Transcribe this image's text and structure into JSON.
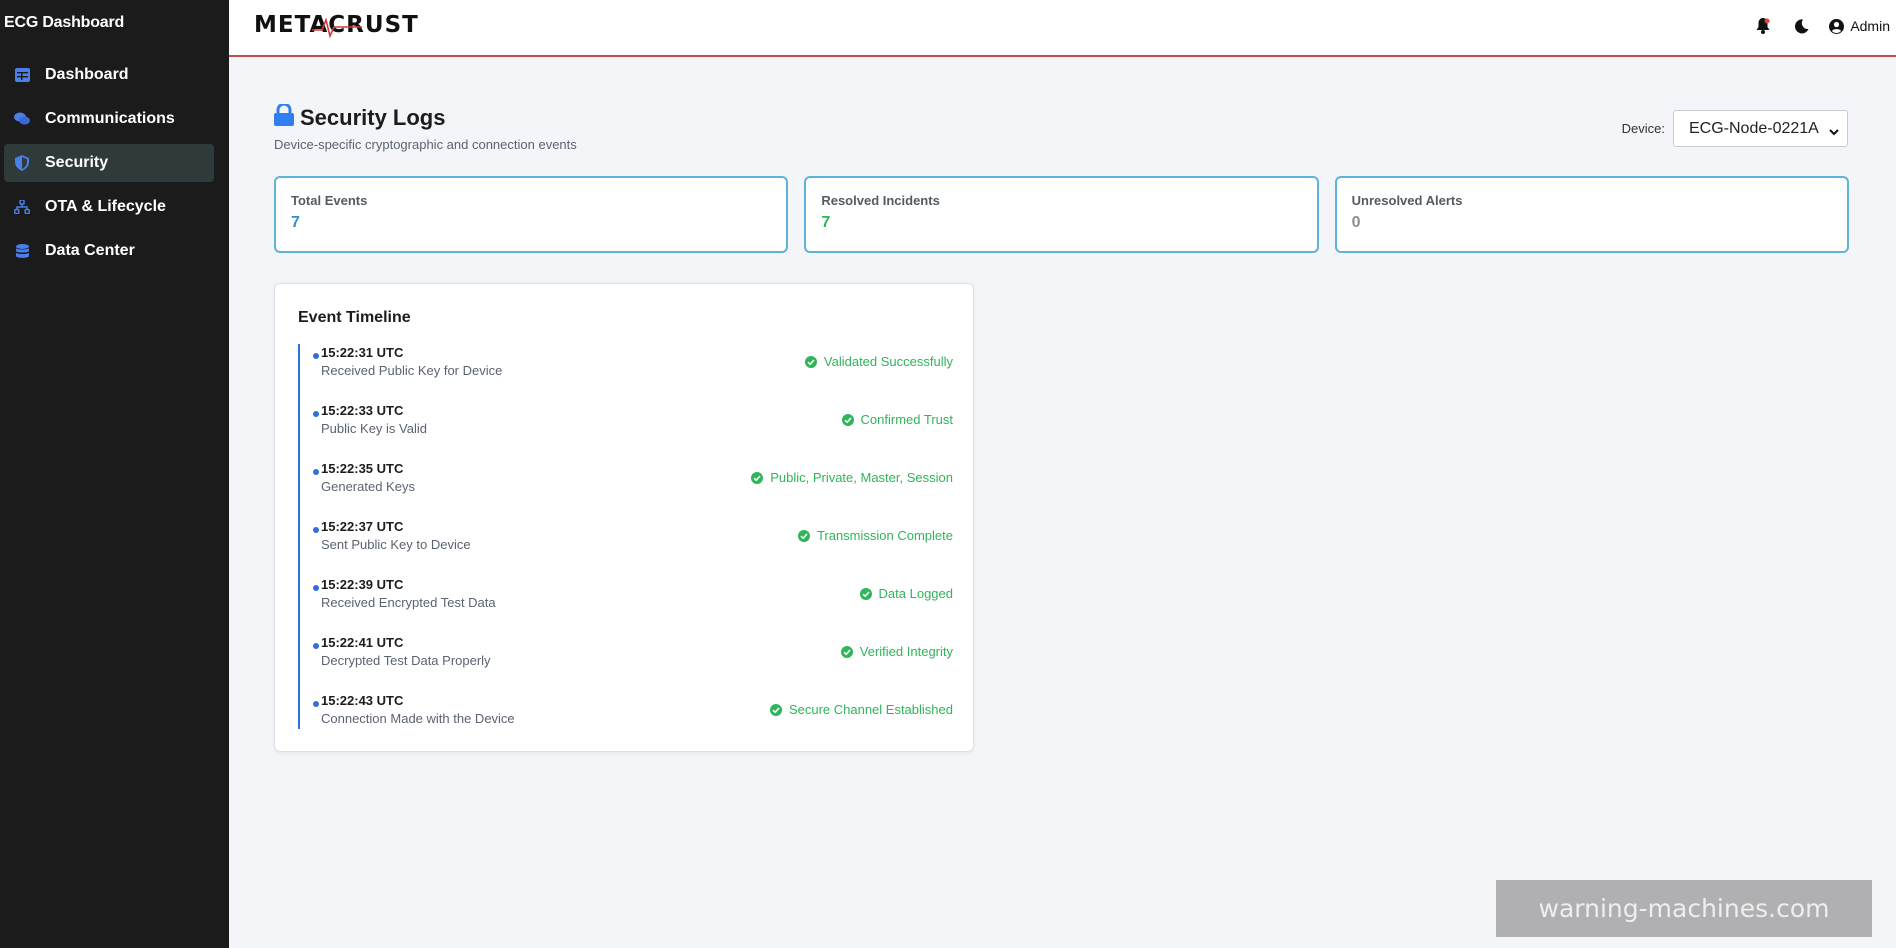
{
  "sidebar": {
    "brand": "ECG Dashboard",
    "items": [
      {
        "label": "Dashboard",
        "icon": "table-icon"
      },
      {
        "label": "Communications",
        "icon": "comments-icon"
      },
      {
        "label": "Security",
        "icon": "shield-icon"
      },
      {
        "label": "OTA & Lifecycle",
        "icon": "sitemap-icon"
      },
      {
        "label": "Data Center",
        "icon": "database-icon"
      }
    ],
    "active": "Security"
  },
  "topbar": {
    "logo": "METACRUST",
    "admin_label": "Admin",
    "accent_color": "#c94a4a"
  },
  "page": {
    "title": "Security Logs",
    "subtitle": "Device-specific cryptographic and connection events",
    "device_label": "Device:",
    "device_selected": "ECG-Node-0221A"
  },
  "cards": [
    {
      "label": "Total Events",
      "value": "7",
      "color": "#2f8fd0"
    },
    {
      "label": "Resolved Incidents",
      "value": "7",
      "color": "#2fb55a"
    },
    {
      "label": "Unresolved Alerts",
      "value": "0",
      "color": "#8a8f96"
    }
  ],
  "timeline": {
    "title": "Event Timeline",
    "events": [
      {
        "time": "15:22:31 UTC",
        "desc": "Received Public Key for Device",
        "status": "Validated Successfully"
      },
      {
        "time": "15:22:33 UTC",
        "desc": "Public Key is Valid",
        "status": "Confirmed Trust"
      },
      {
        "time": "15:22:35 UTC",
        "desc": "Generated Keys",
        "status": "Public, Private, Master, Session"
      },
      {
        "time": "15:22:37 UTC",
        "desc": "Sent Public Key to Device",
        "status": "Transmission Complete"
      },
      {
        "time": "15:22:39 UTC",
        "desc": "Received Encrypted Test Data",
        "status": "Data Logged"
      },
      {
        "time": "15:22:41 UTC",
        "desc": "Decrypted Test Data Properly",
        "status": "Verified Integrity"
      },
      {
        "time": "15:22:43 UTC",
        "desc": "Connection Made with the Device",
        "status": "Secure Channel Established"
      }
    ]
  },
  "watermark": "warning-machines.com"
}
